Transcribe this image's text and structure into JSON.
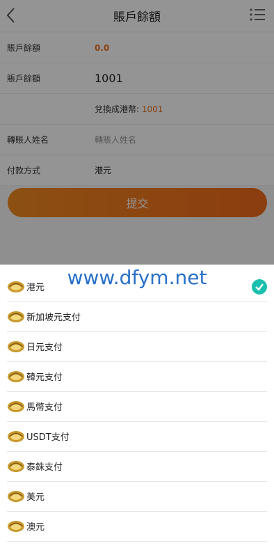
{
  "header": {
    "title": "賬戶餘額",
    "back_icon": "chevron-left-icon",
    "menu_icon": "list-menu-icon"
  },
  "form": {
    "balance": {
      "label": "賬戶餘額",
      "value": "0.0"
    },
    "amount": {
      "label": "賬戶餘額",
      "value": "1001"
    },
    "conversion": {
      "label": "兌換成港幣:",
      "value": "1001"
    },
    "transferee": {
      "label": "轉賬人姓名",
      "placeholder": "轉賬人姓名"
    },
    "payment_method": {
      "label": "付款方式",
      "value": "港元"
    }
  },
  "submit_label": "提交",
  "watermark": "www.dfym.net",
  "options": [
    "港元",
    "新加坡元支付",
    "日元支付",
    "韓元支付",
    "馬幣支付",
    "USDT支付",
    "泰銖支付",
    "美元",
    "澳元"
  ],
  "selected_option": "港元",
  "colors": {
    "accent": "#e8731e",
    "check": "#1bbfae",
    "watermark": "#2a70c7"
  }
}
